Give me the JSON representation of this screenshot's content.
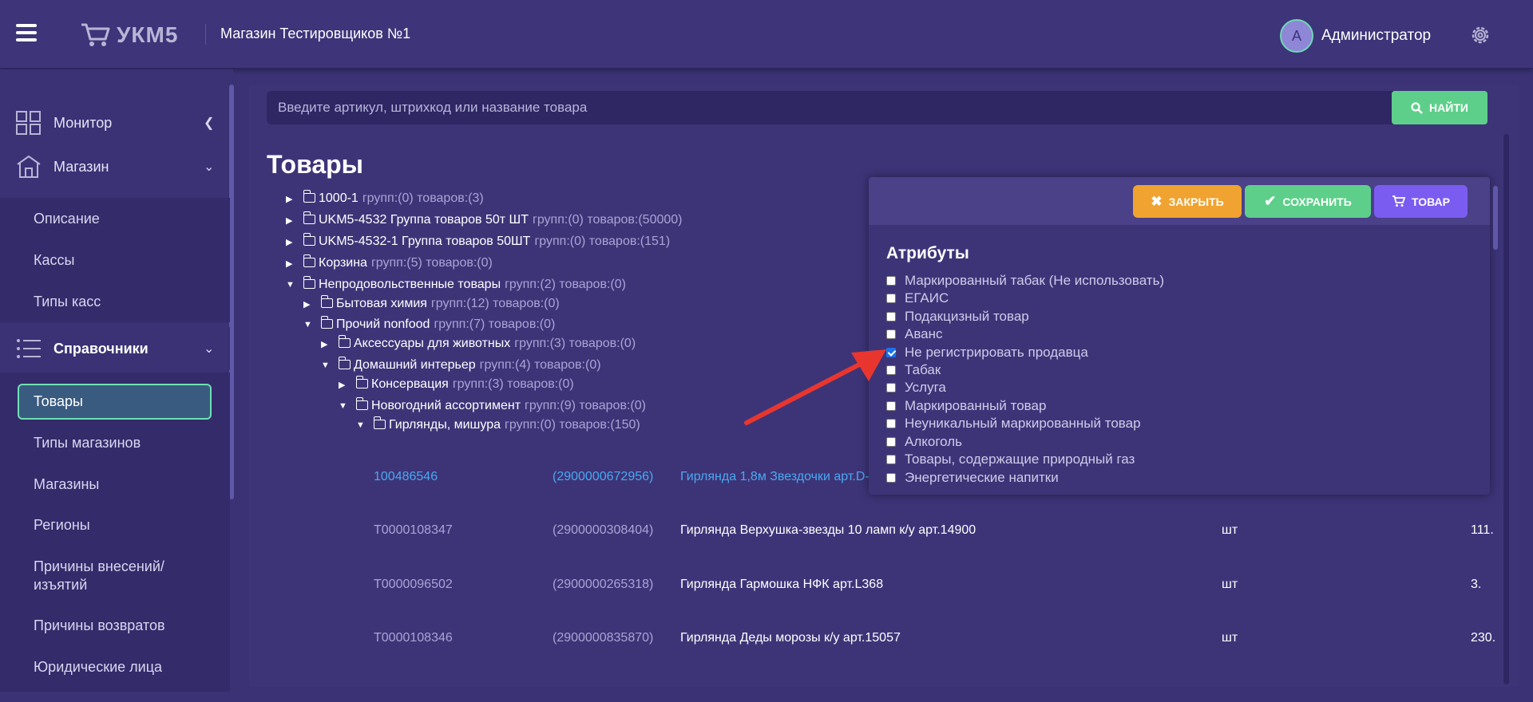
{
  "header": {
    "logo_text": "УКМ5",
    "store_name": "Магазин Тестировщиков №1",
    "avatar_letter": "А",
    "user_name": "Администратор"
  },
  "sidebar": {
    "main_items": [
      {
        "label": "Монитор",
        "icon": "dashboard-grid-icon",
        "chevron": "chevron-left-icon"
      },
      {
        "label": "Магазин",
        "icon": "store-icon",
        "chevron": "chevron-down-icon"
      },
      {
        "label": "Справочники",
        "icon": "list-icon",
        "chevron": "chevron-down-icon"
      }
    ],
    "store_sub": [
      "Описание",
      "Кассы",
      "Типы касс"
    ],
    "directory_sub": [
      "Товары",
      "Типы магазинов",
      "Магазины",
      "Регионы",
      "Причины внесений/ изъятий",
      "Причины возвратов",
      "Юридические лица"
    ],
    "active_item": "Товары"
  },
  "search": {
    "placeholder": "Введите артикул, штрихкод или название товара",
    "value": "",
    "button_label": "НАЙТИ"
  },
  "page": {
    "title": "Товары"
  },
  "tree": [
    {
      "name": "1000-1",
      "meta": "групп:(0) товаров:(3)",
      "expanded": false
    },
    {
      "name": "UKM5-4532 Группа товаров 50т ШТ",
      "meta": "групп:(0) товаров:(50000)",
      "expanded": false
    },
    {
      "name": "UKM5-4532-1 Группа товаров 50ШТ",
      "meta": "групп:(0) товаров:(151)",
      "expanded": false
    },
    {
      "name": "Корзина",
      "meta": "групп:(5) товаров:(0)",
      "expanded": false
    },
    {
      "name": "Непродовольственные товары",
      "meta": "групп:(2) товаров:(0)",
      "expanded": true
    },
    {
      "name": "Бытовая химия",
      "meta": "групп:(12) товаров:(0)",
      "expanded": false
    },
    {
      "name": "Прочий nonfood",
      "meta": "групп:(7) товаров:(0)",
      "expanded": true
    },
    {
      "name": "Аксессуары для животных",
      "meta": "групп:(3) товаров:(0)",
      "expanded": false
    },
    {
      "name": "Домашний интерьер",
      "meta": "групп:(4) товаров:(0)",
      "expanded": true
    },
    {
      "name": "Консервация",
      "meta": "групп:(3) товаров:(0)",
      "expanded": false
    },
    {
      "name": "Новогодний ассортимент",
      "meta": "групп:(9) товаров:(0)",
      "expanded": true
    },
    {
      "name": "Гирлянды, мишура",
      "meta": "групп:(0) товаров:(150)",
      "expanded": true
    }
  ],
  "products": [
    {
      "code": "100486546",
      "barcode": "(2900000672956)",
      "name": "Гирлянда 1,8м Звездочки арт.D-",
      "unit": "",
      "price": "",
      "link": true
    },
    {
      "code": "T0000108347",
      "barcode": "(2900000308404)",
      "name": "Гирлянда Верхушка-звезды 10 ламп к/у арт.14900",
      "unit": "шт",
      "price": "111.",
      "link": false
    },
    {
      "code": "T0000096502",
      "barcode": "(2900000265318)",
      "name": "Гирлянда Гармошка НФК арт.L368",
      "unit": "шт",
      "price": "3.",
      "link": false
    },
    {
      "code": "T0000108346",
      "barcode": "(2900000835870)",
      "name": "Гирлянда Деды морозы к/у арт.15057",
      "unit": "шт",
      "price": "230.",
      "link": false
    }
  ],
  "attributes_modal": {
    "close_label": "ЗАКРЫТЬ",
    "save_label": "СОХРАНИТЬ",
    "product_label": "ТОВАР",
    "title": "Атрибуты",
    "items": [
      {
        "label": "Маркированный табак (Не использовать)",
        "checked": false
      },
      {
        "label": "ЕГАИС",
        "checked": false
      },
      {
        "label": "Подакцизный товар",
        "checked": false
      },
      {
        "label": "Аванс",
        "checked": false
      },
      {
        "label": "Не регистрировать продавца",
        "checked": true
      },
      {
        "label": "Табак",
        "checked": false
      },
      {
        "label": "Услуга",
        "checked": false
      },
      {
        "label": "Маркированный товар",
        "checked": false
      },
      {
        "label": "Неуникальный маркированный товар",
        "checked": false
      },
      {
        "label": "Алкоголь",
        "checked": false
      },
      {
        "label": "Товары, содержащие природный газ",
        "checked": false
      },
      {
        "label": "Энергетические напитки",
        "checked": false
      }
    ]
  },
  "colors": {
    "background": "#3a3275",
    "accent_green": "#5ecf8a",
    "accent_orange": "#f0a330",
    "accent_purple": "#7b5cf0",
    "link_blue": "#4aa8f0",
    "active_border": "#6ee0b3"
  }
}
